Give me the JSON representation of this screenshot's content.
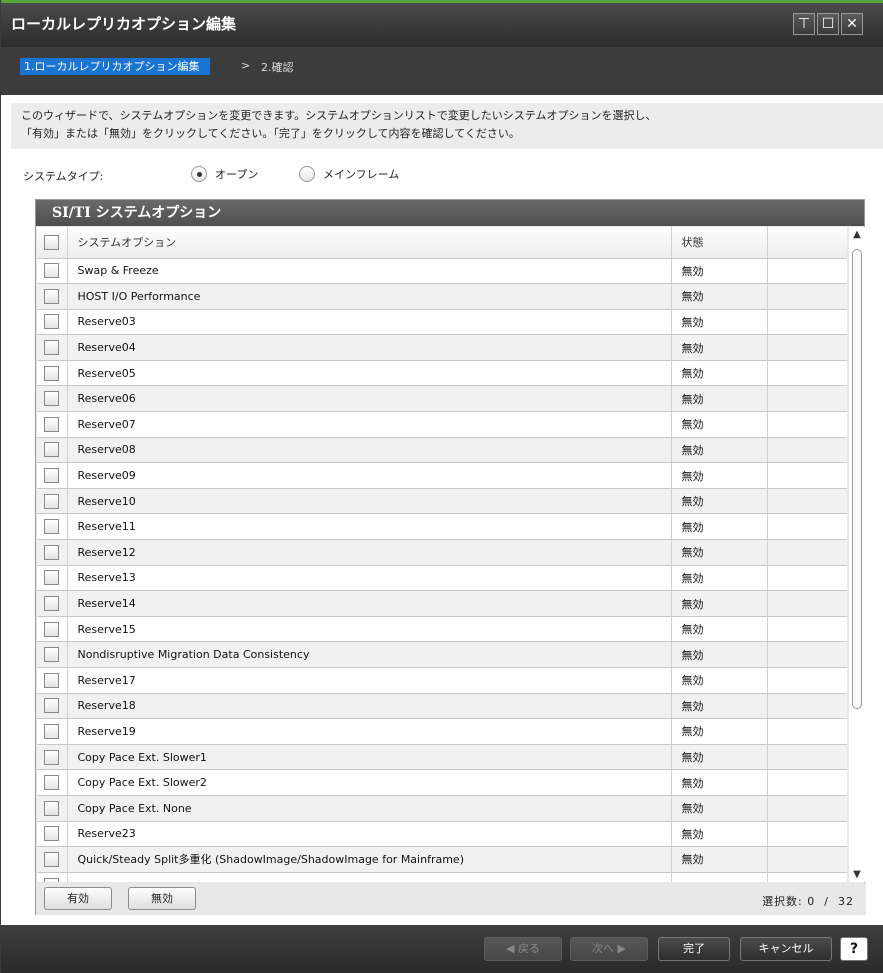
{
  "window": {
    "title": "ローカルレプリカオプション編集",
    "pin_icon": "⊤",
    "max_icon": "☐",
    "close_icon": "✕"
  },
  "steps": {
    "current": "1.ローカルレプリカオプション編集",
    "separator": ">",
    "next": "2.確認"
  },
  "description": {
    "line1": "このウィザードで、システムオプションを変更できます。システムオプションリストで変更したいシステムオプションを選択し、",
    "line2": "「有効」または「無効」をクリックしてください。「完了」をクリックして内容を確認してください。"
  },
  "system_type": {
    "label": "システムタイプ:",
    "options": [
      {
        "label": "オープン",
        "selected": true
      },
      {
        "label": "メインフレーム",
        "selected": false
      }
    ]
  },
  "panel": {
    "title": "SI/TI システムオプション",
    "columns": {
      "option": "システムオプション",
      "status": "状態"
    },
    "rows": [
      {
        "option": "Swap & Freeze",
        "status": "無効"
      },
      {
        "option": "HOST I/O Performance",
        "status": "無効"
      },
      {
        "option": "Reserve03",
        "status": "無効"
      },
      {
        "option": "Reserve04",
        "status": "無効"
      },
      {
        "option": "Reserve05",
        "status": "無効"
      },
      {
        "option": "Reserve06",
        "status": "無効"
      },
      {
        "option": "Reserve07",
        "status": "無効"
      },
      {
        "option": "Reserve08",
        "status": "無効"
      },
      {
        "option": "Reserve09",
        "status": "無効"
      },
      {
        "option": "Reserve10",
        "status": "無効"
      },
      {
        "option": "Reserve11",
        "status": "無効"
      },
      {
        "option": "Reserve12",
        "status": "無効"
      },
      {
        "option": "Reserve13",
        "status": "無効"
      },
      {
        "option": "Reserve14",
        "status": "無効"
      },
      {
        "option": "Reserve15",
        "status": "無効"
      },
      {
        "option": "Nondisruptive Migration Data Consistency",
        "status": "無効"
      },
      {
        "option": "Reserve17",
        "status": "無効"
      },
      {
        "option": "Reserve18",
        "status": "無効"
      },
      {
        "option": "Reserve19",
        "status": "無効"
      },
      {
        "option": "Copy Pace Ext. Slower1",
        "status": "無効"
      },
      {
        "option": "Copy Pace Ext. Slower2",
        "status": "無効"
      },
      {
        "option": "Copy Pace Ext. None",
        "status": "無効"
      },
      {
        "option": "Reserve23",
        "status": "無効"
      },
      {
        "option": "Quick/Steady Split多重化 (ShadowImage/ShadowImage for Mainframe)",
        "status": "無効"
      }
    ],
    "enable_button": "有効",
    "disable_button": "無効",
    "selected_label": "選択数:",
    "selected_count": "0",
    "count_separator": "/",
    "total_count": "32"
  },
  "footer": {
    "back": "◀ 戻る",
    "next": "次へ ▶",
    "finish": "完了",
    "cancel": "キャンセル",
    "help": "?"
  }
}
